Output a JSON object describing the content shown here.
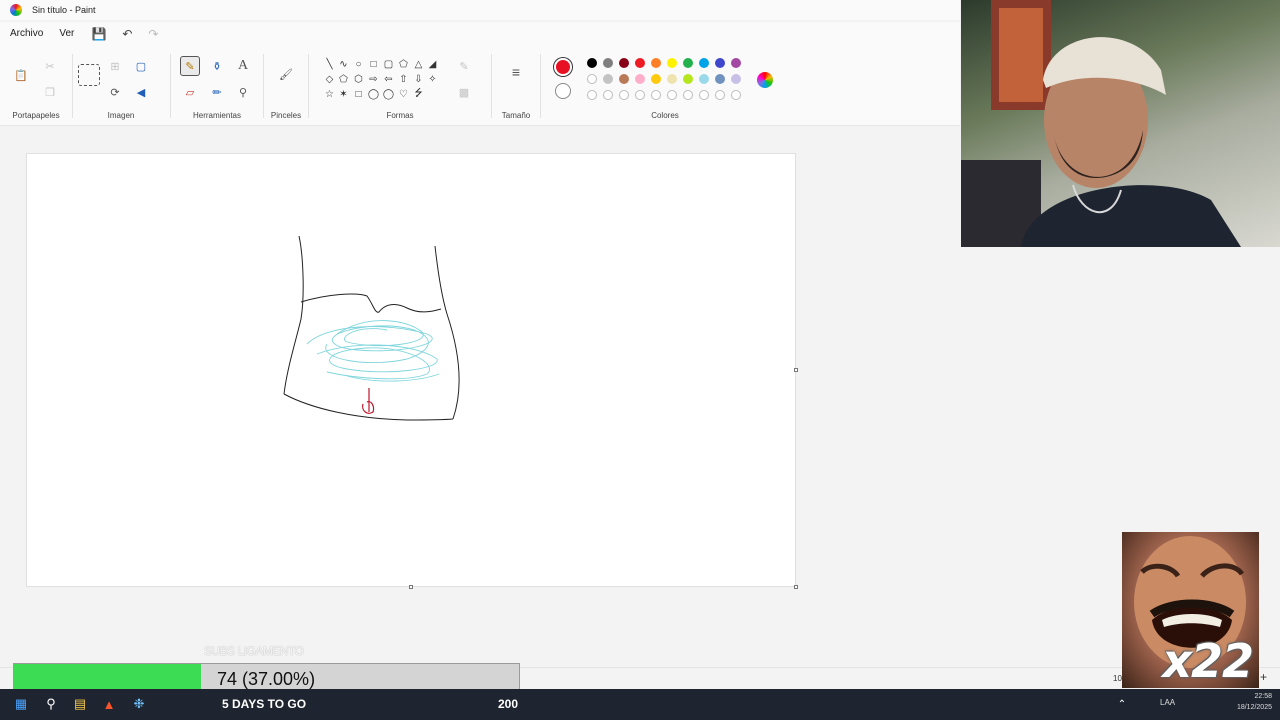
{
  "window": {
    "title": "Sin título - Paint"
  },
  "menu": {
    "items": [
      "Archivo",
      "Ver"
    ]
  },
  "ribbon": {
    "groups": {
      "clipboard": "Portapapeles",
      "image": "Imagen",
      "tools": "Herramientas",
      "brushes": "Pinceles",
      "shapes": "Formas",
      "size": "Tamaño",
      "colors": "Colores"
    },
    "text_tool_glyph": "A",
    "primary_color": "#e81123",
    "secondary_color": "#ffffff",
    "palette_row1": [
      "#000000",
      "#7f7f7f",
      "#880015",
      "#ed1c24",
      "#ff7f27",
      "#fff200",
      "#22b14c",
      "#00a2e8",
      "#3f48cc",
      "#a349a4"
    ],
    "palette_row2": [
      "#ffffff",
      "#c3c3c3",
      "#b97a57",
      "#ffaec9",
      "#ffc90e",
      "#efe4b0",
      "#b5e61d",
      "#99d9ea",
      "#7092be",
      "#c8bfe7"
    ]
  },
  "status": {
    "zoom": "100 %"
  },
  "overlay": {
    "subs_label": "SUBS LIGAMENTO",
    "progress_text": "74 (37.00%)",
    "progress_fraction": 0.37,
    "days_text": "5 DAYS TO GO",
    "count_text": "200"
  },
  "meme": {
    "text": "x22"
  },
  "taskbar": {
    "lang": "LAA",
    "time": "22:58",
    "date": "18/12/2025"
  }
}
